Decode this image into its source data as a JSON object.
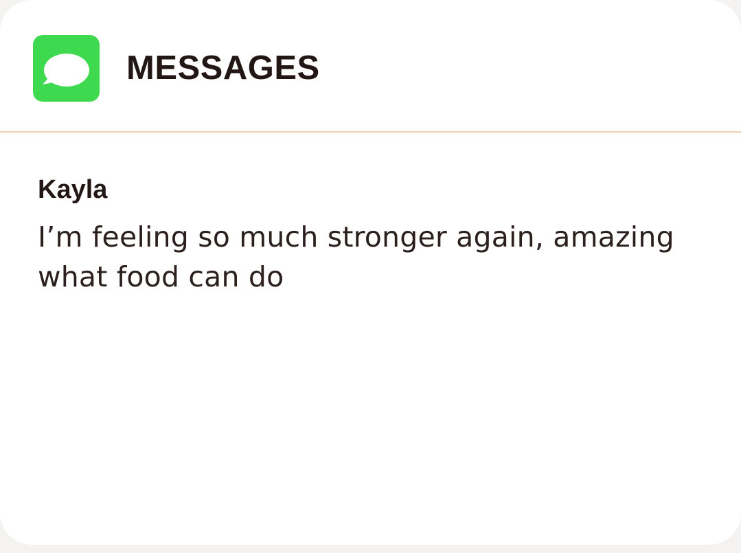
{
  "header": {
    "app_icon": "messages-icon",
    "app_icon_color": "#3fd950",
    "title": "MESSAGES"
  },
  "notification": {
    "sender": "Kayla",
    "message": "I’m feeling so much stronger again, amazing what food can do"
  },
  "colors": {
    "divider": "#ecd1b3",
    "text": "#231716",
    "card_background": "#ffffff"
  }
}
